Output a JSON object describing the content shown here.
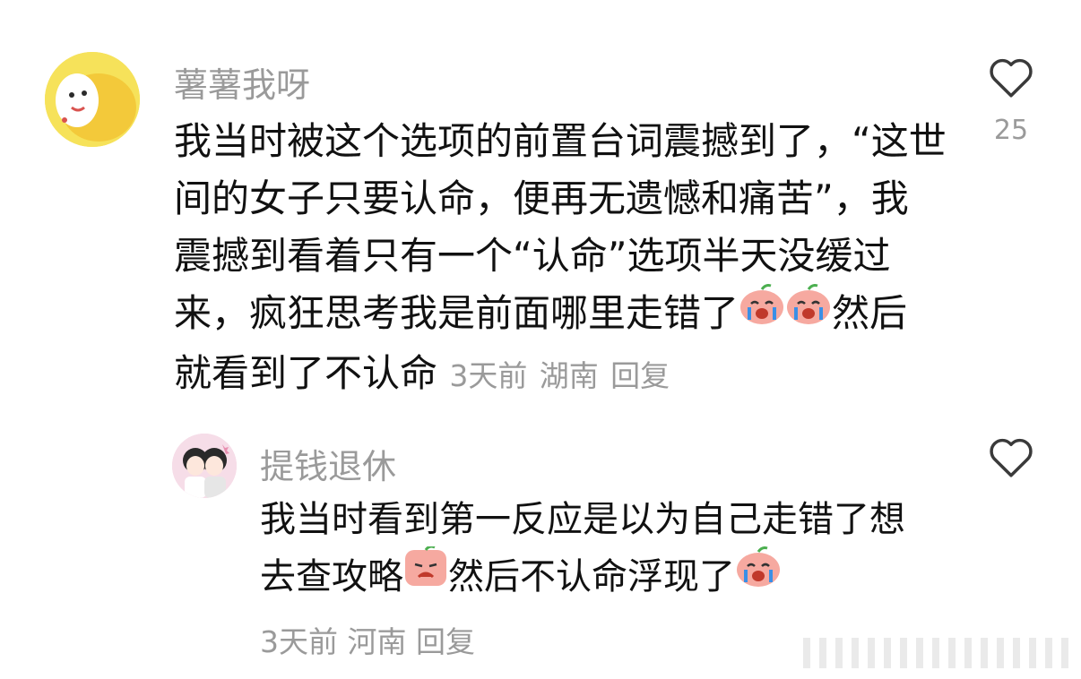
{
  "comments": [
    {
      "username": "薯薯我呀",
      "lines": [
        "我当时被这个选项的前置台词震撼到了，“这世",
        "间的女子只要认命，便再无遗憾和痛苦”，我",
        "震撼到看着只有一个“认命”选项半天没缓过",
        "来，疯狂思考我是前面哪里走错了"
      ],
      "line4_after_emoji": "然后",
      "line5": "就看到了不认命",
      "meta": {
        "time": "3天前",
        "location": "湖南",
        "reply": "回复"
      },
      "like_count": "25",
      "icons": {
        "like": "heart-outline-icon",
        "emoji": "crying-peach-emoji"
      }
    },
    {
      "username": "提钱退休",
      "line1": "我当时看到第一反应是以为自己走错了想",
      "line2_a": "去查攻略",
      "line2_b": "然后不认命浮现了",
      "meta": {
        "time": "3天前",
        "location": "河南",
        "reply": "回复"
      },
      "icons": {
        "like": "heart-outline-icon",
        "emoji": "crying-peach-emoji"
      }
    }
  ],
  "colors": {
    "text": "#111111",
    "secondary": "#9a9a9a",
    "emoji": "#f6a9a0"
  }
}
